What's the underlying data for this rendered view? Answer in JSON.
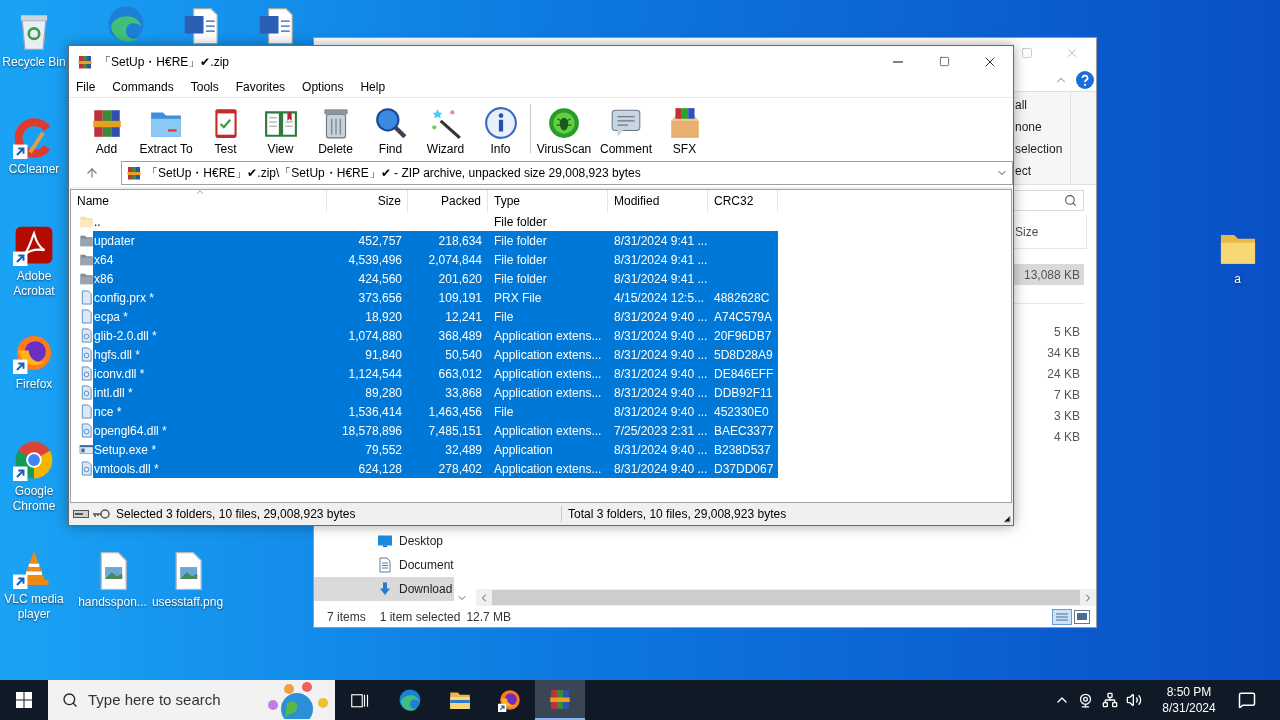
{
  "desktop_icons": [
    {
      "kind": "recycle",
      "label": "Recycle Bin"
    },
    {
      "kind": "edge"
    },
    {
      "kind": "word"
    },
    {
      "kind": "word"
    },
    {
      "kind": "ccleaner",
      "label": "CCleaner"
    },
    {
      "kind": "acrobat",
      "label": "Adobe Acrobat"
    },
    {
      "kind": "firefox",
      "label": "Firefox"
    },
    {
      "kind": "chrome",
      "label": "Google Chrome"
    },
    {
      "kind": "vlc",
      "label": "VLC media player"
    },
    {
      "kind": "image",
      "label": "handsspon..."
    },
    {
      "kind": "image",
      "label": "usesstaff.png"
    },
    {
      "kind": "folder",
      "label": "a"
    }
  ],
  "explorer": {
    "ribbon_items": [
      "all",
      "none",
      "selection",
      "ect"
    ],
    "size_header": "Size",
    "size_groups": [
      {
        "rows": [
          {
            "text": "13,088 KB",
            "selected": true
          }
        ]
      },
      {
        "rows": [
          {
            "text": "5 KB",
            "selected": false
          },
          {
            "text": "34 KB",
            "selected": false
          },
          {
            "text": "24 KB",
            "selected": false
          },
          {
            "text": "7 KB",
            "selected": false
          },
          {
            "text": "3 KB",
            "selected": false
          },
          {
            "text": "4 KB",
            "selected": false
          }
        ]
      }
    ],
    "nav": [
      {
        "label": "Desktop",
        "kind": "desktop",
        "selected": false
      },
      {
        "label": "Document",
        "kind": "documents",
        "selected": false
      },
      {
        "label": "Download",
        "kind": "downloads",
        "selected": true
      }
    ],
    "status": {
      "count": "7 items",
      "selection": "1 item selected",
      "size": "12.7 MB"
    }
  },
  "winrar": {
    "title": "「SetUp・H€RE」✔.zip",
    "menu": [
      "File",
      "Commands",
      "Tools",
      "Favorites",
      "Options",
      "Help"
    ],
    "toolbar": [
      {
        "label": "Add",
        "kind": "add"
      },
      {
        "label": "Extract To",
        "kind": "extract"
      },
      {
        "label": "Test",
        "kind": "test"
      },
      {
        "label": "View",
        "kind": "view"
      },
      {
        "label": "Delete",
        "kind": "delete"
      },
      {
        "label": "Find",
        "kind": "find"
      },
      {
        "label": "Wizard",
        "kind": "wizard"
      },
      {
        "label": "Info",
        "kind": "info"
      },
      {
        "kind": "separator"
      },
      {
        "label": "VirusScan",
        "kind": "virusscan"
      },
      {
        "label": "Comment",
        "kind": "comment"
      },
      {
        "label": "SFX",
        "kind": "sfx"
      }
    ],
    "address": "「SetUp・H€RE」✔.zip\\「SetUp・H€RE」✔ - ZIP archive, unpacked size 29,008,923 bytes",
    "columns": [
      "Name",
      "Size",
      "Packed",
      "Type",
      "Modified",
      "CRC32"
    ],
    "rows": [
      {
        "kind": "folder_up",
        "name": "..",
        "type": "File folder",
        "selected": false
      },
      {
        "kind": "folder",
        "name": "updater",
        "size": "452,757",
        "packed": "218,634",
        "type": "File folder",
        "modified": "8/31/2024 9:41 ...",
        "selected": true
      },
      {
        "kind": "folder",
        "name": "x64",
        "size": "4,539,496",
        "packed": "2,074,844",
        "type": "File folder",
        "modified": "8/31/2024 9:41 ...",
        "selected": true
      },
      {
        "kind": "folder",
        "name": "x86",
        "size": "424,560",
        "packed": "201,620",
        "type": "File folder",
        "modified": "8/31/2024 9:41 ...",
        "selected": true
      },
      {
        "kind": "file",
        "name": "config.prx *",
        "size": "373,656",
        "packed": "109,191",
        "type": "PRX File",
        "modified": "4/15/2024 12:5...",
        "crc": "4882628C",
        "selected": true
      },
      {
        "kind": "file",
        "name": "ecpa *",
        "size": "18,920",
        "packed": "12,241",
        "type": "File",
        "modified": "8/31/2024 9:40 ...",
        "crc": "A74C579A",
        "selected": true
      },
      {
        "kind": "dll",
        "name": "glib-2.0.dll *",
        "size": "1,074,880",
        "packed": "368,489",
        "type": "Application extens...",
        "modified": "8/31/2024 9:40 ...",
        "crc": "20F96DB7",
        "selected": true
      },
      {
        "kind": "dll",
        "name": "hgfs.dll *",
        "size": "91,840",
        "packed": "50,540",
        "type": "Application extens...",
        "modified": "8/31/2024 9:40 ...",
        "crc": "5D8D28A9",
        "selected": true
      },
      {
        "kind": "dll",
        "name": "iconv.dll *",
        "size": "1,124,544",
        "packed": "663,012",
        "type": "Application extens...",
        "modified": "8/31/2024 9:40 ...",
        "crc": "DE846EFF",
        "selected": true
      },
      {
        "kind": "dll",
        "name": "intl.dll *",
        "size": "89,280",
        "packed": "33,868",
        "type": "Application extens...",
        "modified": "8/31/2024 9:40 ...",
        "crc": "DDB92F11",
        "selected": true
      },
      {
        "kind": "file",
        "name": "nce *",
        "size": "1,536,414",
        "packed": "1,463,456",
        "type": "File",
        "modified": "8/31/2024 9:40 ...",
        "crc": "452330E0",
        "selected": true
      },
      {
        "kind": "dll",
        "name": "opengl64.dll *",
        "size": "18,578,896",
        "packed": "7,485,151",
        "type": "Application extens...",
        "modified": "7/25/2023 2:31 ...",
        "crc": "BAEC3377",
        "selected": true
      },
      {
        "kind": "exe",
        "name": "Setup.exe *",
        "size": "79,552",
        "packed": "32,489",
        "type": "Application",
        "modified": "8/31/2024 9:40 ...",
        "crc": "B238D537",
        "selected": true
      },
      {
        "kind": "dll",
        "name": "vmtools.dll *",
        "size": "624,128",
        "packed": "278,402",
        "type": "Application extens...",
        "modified": "8/31/2024 9:40 ...",
        "crc": "D37DD067",
        "selected": true
      }
    ],
    "status_left": "Selected 3 folders, 10 files, 29,008,923 bytes",
    "status_right": "Total 3 folders, 10 files, 29,008,923 bytes"
  },
  "taskbar": {
    "search_placeholder": "Type here to search",
    "apps": [
      {
        "kind": "taskview",
        "active": false
      },
      {
        "kind": "edge",
        "active": false
      },
      {
        "kind": "explorer",
        "active": false
      },
      {
        "kind": "firefox",
        "active": false
      },
      {
        "kind": "winrar",
        "active": true
      }
    ],
    "time": "8:50 PM",
    "date": "8/31/2024"
  }
}
